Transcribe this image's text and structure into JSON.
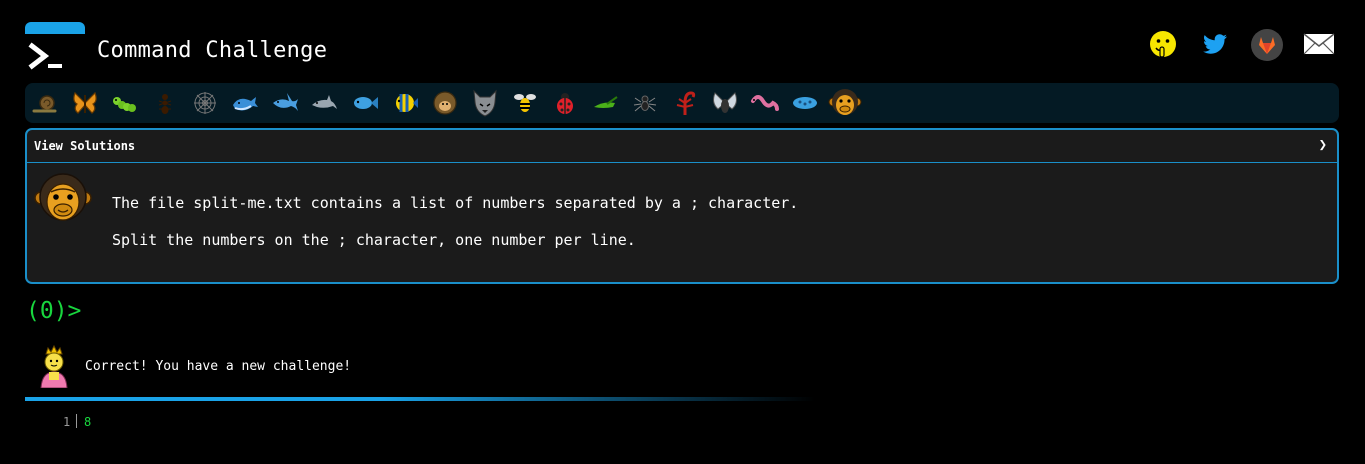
{
  "header": {
    "title": "Command Challenge",
    "logo_icon": "terminal-prompt-icon"
  },
  "social": [
    {
      "name": "shush-face-icon",
      "color": "#f7e600"
    },
    {
      "name": "twitter-icon",
      "color": "#1da1f2"
    },
    {
      "name": "gitlab-icon",
      "color": "#fc6d26"
    },
    {
      "name": "mail-icon",
      "color": "#ffffff"
    }
  ],
  "animals": [
    "snail",
    "butterfly",
    "caterpillar",
    "ant",
    "spider-web",
    "whale",
    "shark",
    "dolphin",
    "fish",
    "tropical-fish",
    "hedgehog",
    "wolf",
    "bee",
    "ladybug",
    "cricket",
    "spider",
    "scorpion",
    "fly",
    "worm",
    "microbe",
    "monkey"
  ],
  "panel": {
    "header_label": "View Solutions",
    "chevron": "❯",
    "lines": [
      "The file split-me.txt contains a list of numbers separated by a ; character.",
      "Split the numbers on the ; character, one number per line."
    ]
  },
  "prompt": "(0)>",
  "result": {
    "message": "Correct! You have a new challenge!",
    "avatar": "princess-icon",
    "accent": "#1aa3e8"
  },
  "output": {
    "line_number": "1",
    "value": "8"
  }
}
